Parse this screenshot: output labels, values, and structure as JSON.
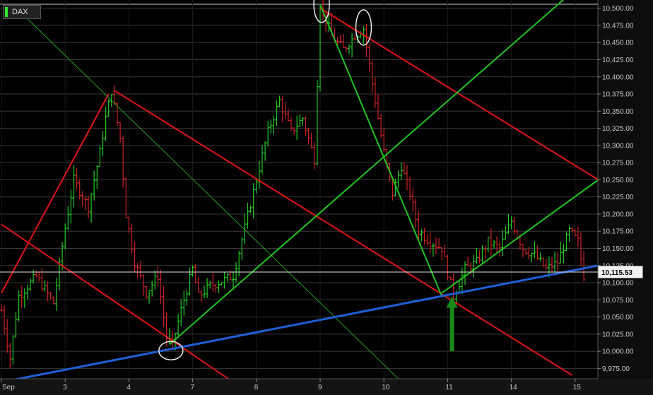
{
  "symbol": "DAX",
  "colors": {
    "background": "#000000",
    "grid": "#3a3a3a",
    "axis_panel": "#1a1a1a",
    "up_bar": "#22cc22",
    "down_bar": "#cc2222",
    "blue_trend": "#1f5fd8",
    "green_line": "#21c421",
    "red_line": "#e01515",
    "arrow": "#1a8a1a",
    "circle": "#e8e8e8",
    "last_price_line": "#e0e0e0"
  },
  "chart_data": {
    "type": "ohlc",
    "title": "",
    "ylim": [
      9960,
      10512
    ],
    "y_ticks": [
      "9,975.00",
      "10,000.00",
      "10,025.00",
      "10,050.00",
      "10,075.00",
      "10,100.00",
      "10,125.00",
      "10,150.00",
      "10,175.00",
      "10,200.00",
      "10,225.00",
      "10,250.00",
      "10,275.00",
      "10,300.00",
      "10,325.00",
      "10,350.00",
      "10,375.00",
      "10,400.00",
      "10,425.00",
      "10,450.00",
      "10,475.00",
      "10,500.00"
    ],
    "y_tick_values": [
      9975,
      10000,
      10025,
      10050,
      10075,
      10100,
      10125,
      10150,
      10175,
      10200,
      10225,
      10250,
      10275,
      10300,
      10325,
      10350,
      10375,
      10400,
      10425,
      10450,
      10475,
      10500
    ],
    "x_labels": [
      "Sep",
      "3",
      "4",
      "7",
      "8",
      "9",
      "10",
      "11",
      "14",
      "15"
    ],
    "x_label_bar_index": [
      0,
      22,
      44,
      66,
      88,
      110,
      132,
      154,
      176,
      198
    ],
    "last_price": 10115.53,
    "last_price_label": "10,115.53",
    "keypoints": [
      [
        0,
        10060
      ],
      [
        3,
        9990
      ],
      [
        6,
        10080
      ],
      [
        12,
        10110
      ],
      [
        18,
        10070
      ],
      [
        22,
        10180
      ],
      [
        25,
        10250
      ],
      [
        30,
        10210
      ],
      [
        34,
        10290
      ],
      [
        36,
        10340
      ],
      [
        38,
        10380
      ],
      [
        41,
        10310
      ],
      [
        43,
        10200
      ],
      [
        46,
        10130
      ],
      [
        50,
        10085
      ],
      [
        54,
        10110
      ],
      [
        57,
        10020
      ],
      [
        59,
        10010
      ],
      [
        62,
        10060
      ],
      [
        66,
        10120
      ],
      [
        68,
        10080
      ],
      [
        72,
        10095
      ],
      [
        80,
        10110
      ],
      [
        84,
        10180
      ],
      [
        88,
        10250
      ],
      [
        92,
        10320
      ],
      [
        96,
        10365
      ],
      [
        100,
        10320
      ],
      [
        104,
        10340
      ],
      [
        108,
        10280
      ],
      [
        110,
        10505
      ],
      [
        114,
        10460
      ],
      [
        118,
        10440
      ],
      [
        122,
        10460
      ],
      [
        125,
        10470
      ],
      [
        128,
        10390
      ],
      [
        132,
        10290
      ],
      [
        135,
        10230
      ],
      [
        138,
        10270
      ],
      [
        141,
        10230
      ],
      [
        144,
        10175
      ],
      [
        148,
        10160
      ],
      [
        152,
        10150
      ],
      [
        156,
        10080
      ],
      [
        160,
        10120
      ],
      [
        164,
        10130
      ],
      [
        168,
        10160
      ],
      [
        172,
        10150
      ],
      [
        176,
        10190
      ],
      [
        180,
        10150
      ],
      [
        184,
        10140
      ],
      [
        188,
        10120
      ],
      [
        192,
        10130
      ],
      [
        196,
        10175
      ],
      [
        199,
        10160
      ],
      [
        201,
        10110
      ]
    ],
    "overlay_lines": [
      {
        "name": "",
        "color": "red",
        "points": [
          [
            0,
            10085
          ],
          [
            37,
            10375
          ]
        ]
      },
      {
        "name": "",
        "color": "red",
        "points": [
          [
            39,
            10380
          ],
          [
            197,
            9965
          ]
        ]
      },
      {
        "name": "",
        "color": "red",
        "points": [
          [
            0,
            10185
          ],
          [
            80,
            9955
          ]
        ]
      },
      {
        "name": "",
        "color": "red",
        "points": [
          [
            110,
            10500
          ],
          [
            206,
            10250
          ]
        ]
      },
      {
        "name": "",
        "color": "green",
        "points": [
          [
            58,
            10010
          ],
          [
            196,
            10520
          ]
        ]
      },
      {
        "name": "",
        "color": "green",
        "points": [
          [
            152,
            10085
          ],
          [
            206,
            10250
          ]
        ]
      },
      {
        "name": "",
        "color": "green",
        "points": [
          [
            110,
            10505
          ],
          [
            152,
            10080
          ]
        ]
      },
      {
        "name": "",
        "color": "green_thin",
        "points": [
          [
            4,
            10505
          ],
          [
            137,
            9960
          ]
        ]
      },
      {
        "name": "",
        "color": "blue",
        "points": [
          [
            0,
            9955
          ],
          [
            206,
            10125
          ]
        ]
      }
    ],
    "annotations": [
      {
        "type": "circle",
        "bar": 58.5,
        "value": 10001
      },
      {
        "type": "circle",
        "bar": 110.5,
        "value": 10505
      },
      {
        "type": "circle",
        "bar": 125,
        "value": 10472
      },
      {
        "type": "up_arrow",
        "bar": 155.5,
        "from": 10000,
        "to": 10080
      }
    ]
  }
}
